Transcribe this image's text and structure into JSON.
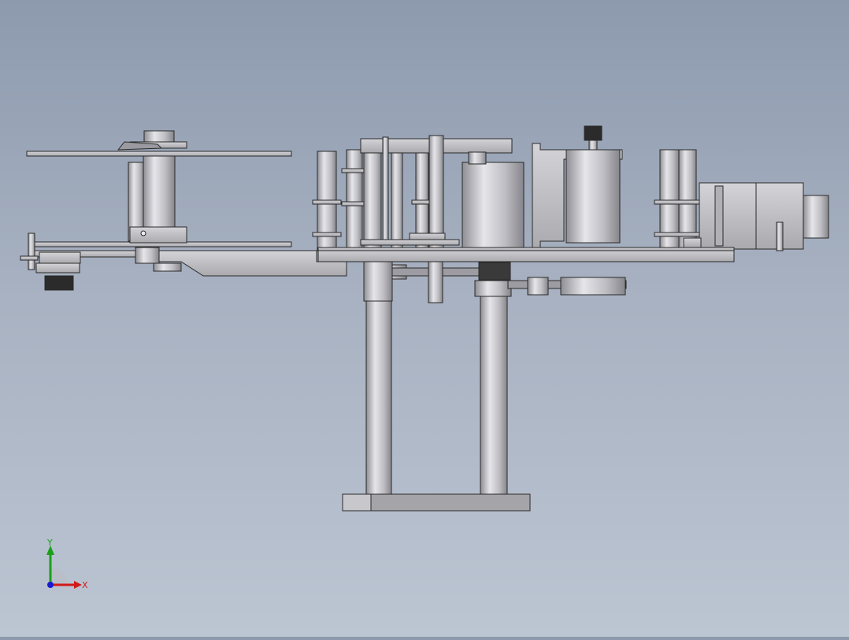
{
  "view": {
    "background_top": "#8d9aae",
    "background_bottom": "#bcc5d2",
    "part_color": "#c4c4c8",
    "edge_color": "#2a2a2a"
  },
  "triad": {
    "x_label": "X",
    "y_label": "Y",
    "x_color": "#d11a1a",
    "y_color": "#1aa01a",
    "z_color": "#1a1ad1"
  }
}
